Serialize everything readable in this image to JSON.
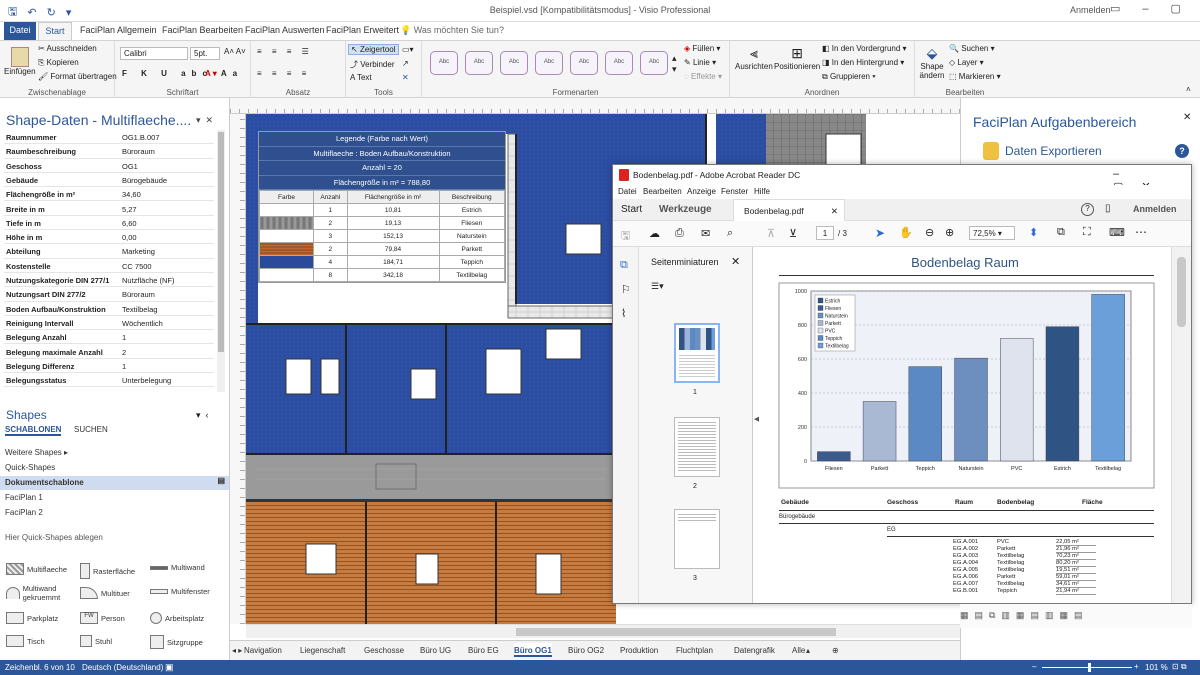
{
  "app": {
    "window_title": "Beispiel.vsd  [Kompatibilitätsmodus]  -  Visio Professional",
    "signin": "Anmelden"
  },
  "ribbon_tabs": [
    "Datei",
    "Start",
    "FaciPlan Allgemein",
    "FaciPlan Bearbeiten",
    "FaciPlan Auswerten",
    "FaciPlan Erweitert"
  ],
  "search_placeholder": "Was möchten Sie tun?",
  "ribbon": {
    "clipboard": {
      "paste": "Einfügen",
      "cut": "Ausschneiden",
      "copy": "Kopieren",
      "format": "Format übertragen",
      "label": "Zwischenablage"
    },
    "font": {
      "name": "Calibri",
      "size": "5pt.",
      "label": "Schriftart"
    },
    "paragraph": {
      "label": "Absatz"
    },
    "tools": {
      "pointer": "Zeigertool",
      "connector": "Verbinder",
      "text": "Text",
      "label": "Tools"
    },
    "shape_styles": {
      "sample": "Abc",
      "fill": "Füllen",
      "line": "Linie",
      "effects": "Effekte",
      "label": "Formenarten"
    },
    "arrange": {
      "align": "Ausrichten",
      "position": "Positionieren",
      "front": "In den Vordergrund",
      "back": "In den Hintergrund",
      "group": "Gruppieren",
      "label": "Anordnen"
    },
    "editing": {
      "change_shape": "Shape ändern",
      "find": "Suchen",
      "layer": "Layer",
      "select": "Markieren",
      "label": "Bearbeiten"
    }
  },
  "shape_data": {
    "title": "Shape-Daten - Multiflaeche....",
    "rows": [
      {
        "k": "Raumnummer",
        "v": "OG1.B.007"
      },
      {
        "k": "Raumbeschreibung",
        "v": "Büroraum"
      },
      {
        "k": "Geschoss",
        "v": "OG1"
      },
      {
        "k": "Gebäude",
        "v": "Bürogebäude"
      },
      {
        "k": "Flächengröße in m²",
        "v": "34,60"
      },
      {
        "k": "Breite in m",
        "v": "5,27"
      },
      {
        "k": "Tiefe in m",
        "v": "6,60"
      },
      {
        "k": "Höhe in m",
        "v": "0,00"
      },
      {
        "k": "Abteilung",
        "v": "Marketing"
      },
      {
        "k": "Kostenstelle",
        "v": "CC 7500"
      },
      {
        "k": "Nutzungskategorie DIN 277/1",
        "v": "Nutzfläche (NF)"
      },
      {
        "k": "Nutzungsart DIN 277/2",
        "v": "Büroraum"
      },
      {
        "k": "Boden Aufbau/Konstruktion",
        "v": "Textilbelag"
      },
      {
        "k": "Reinigung Intervall",
        "v": "Wöchentlich"
      },
      {
        "k": "Belegung Anzahl",
        "v": "1"
      },
      {
        "k": "Belegung maximale Anzahl",
        "v": "2"
      },
      {
        "k": "Belegung Differenz",
        "v": "1"
      },
      {
        "k": "Belegungsstatus",
        "v": "Unterbelegung"
      }
    ]
  },
  "shapes": {
    "title": "Shapes",
    "tab_templates": "SCHABLONEN",
    "tab_search": "SUCHEN",
    "more": "Weitere Shapes",
    "quick": "Quick-Shapes",
    "doc_template": "Dokumentschablone",
    "faci1": "FaciPlan 1",
    "faci2": "FaciPlan 2",
    "drop_hint": "Hier Quick-Shapes ablegen",
    "stencils": [
      "Multiflaeche",
      "Rasterfläche",
      "Multiwand",
      "Multiwand gekruemmt",
      "Multituer",
      "Multifenster",
      "Parkplatz",
      "Person",
      "Arbeitsplatz",
      "Tisch",
      "Stuhl",
      "Sitzgruppe"
    ]
  },
  "legend": {
    "title": "Legende (Farbe nach Wert)",
    "subtitle": "Multiflaeche : Boden Aufbau/Konstruktion",
    "count": "Anzahl = 20",
    "area": "Flächengröße in m² = 788,80",
    "headers": [
      "Farbe",
      "Anzahl",
      "Flächengröße in m²",
      "Beschreibung"
    ],
    "rows": [
      {
        "color": "#ffffff",
        "n": "1",
        "a": "10,81",
        "d": "Estrich"
      },
      {
        "color": "#888888",
        "n": "2",
        "a": "19,13",
        "d": "Fliesen"
      },
      {
        "color": "#ffffff",
        "n": "3",
        "a": "152,13",
        "d": "Naturstein"
      },
      {
        "color": "#c0662e",
        "n": "2",
        "a": "79,84",
        "d": "Parkett"
      },
      {
        "color": "#2b4a9c",
        "n": "4",
        "a": "184,71",
        "d": "Teppich"
      },
      {
        "color": "#ffffff",
        "n": "8",
        "a": "342,18",
        "d": "Textilbelag"
      }
    ]
  },
  "task_pane": {
    "title": "FaciPlan Aufgabenbereich",
    "export": "Daten Exportieren"
  },
  "acrobat": {
    "title": "Bodenbelag.pdf - Adobe Acrobat Reader DC",
    "menu": [
      "Datei",
      "Bearbeiten",
      "Anzeige",
      "Fenster",
      "Hilfe"
    ],
    "tab_home": "Start",
    "tab_tools": "Werkzeuge",
    "doc_tab": "Bodenbelag.pdf",
    "signin": "Anmelden",
    "page_current": "1",
    "page_total": "/ 3",
    "zoom": "72,5%",
    "thumbs_title": "Seitenminiaturen",
    "thumb_pages": [
      "1",
      "2",
      "3"
    ],
    "table_headers": [
      "Gebäude",
      "Geschoss",
      "Raum",
      "Bodenbelag",
      "Fläche"
    ],
    "building": "Bürogebäude",
    "floor": "EG",
    "rows": [
      {
        "r": "EG.A.001",
        "b": "PVC",
        "f": "22,05 m²"
      },
      {
        "r": "EG.A.002",
        "b": "Parkett",
        "f": "21,96 m²"
      },
      {
        "r": "EG.A.003",
        "b": "Textilbelag",
        "f": "70,23 m²"
      },
      {
        "r": "EG.A.004",
        "b": "Textilbelag",
        "f": "80,20 m²"
      },
      {
        "r": "EG.A.005",
        "b": "Textilbelag",
        "f": "19,51 m²"
      },
      {
        "r": "EG.A.006",
        "b": "Parkett",
        "f": "59,01 m²"
      },
      {
        "r": "EG.A.007",
        "b": "Textilbelag",
        "f": "34,61 m²"
      },
      {
        "r": "EG.B.001",
        "b": "Teppich",
        "f": "21,94 m²"
      }
    ]
  },
  "chart_data": {
    "type": "bar",
    "title": "Bodenbelag Raum",
    "categories": [
      "Fliesen",
      "Parkett",
      "Teppich",
      "Naturstein",
      "PVC",
      "Estrich",
      "Textilbelag"
    ],
    "values": [
      55,
      350,
      555,
      605,
      720,
      790,
      980
    ],
    "colors": [
      "#3b5b8f",
      "#a9b9d3",
      "#5b89c4",
      "#6d8fc0",
      "#dfe3ee",
      "#2f5484",
      "#6a9fd9"
    ],
    "ylim": [
      0,
      1000
    ],
    "yticks": [
      "0",
      "200",
      "400",
      "600",
      "800",
      "1000"
    ],
    "legend": [
      "Estrich",
      "Fliesen",
      "Naturstein",
      "Parkett",
      "PVC",
      "Teppich",
      "Textilbelag"
    ],
    "legend_colors": [
      "#2f5484",
      "#3b5b8f",
      "#6d8fc0",
      "#a9b9d3",
      "#dfe3ee",
      "#5b89c4",
      "#6a9fd9"
    ],
    "grid": true,
    "legend_position": "top-left"
  },
  "page_tabs": [
    "Navigation",
    "Liegenschaft",
    "Geschosse",
    "Büro UG",
    "Büro EG",
    "Büro OG1",
    "Büro OG2",
    "Produktion",
    "Fluchtplan",
    "Datengrafik",
    "Alle"
  ],
  "status": {
    "left": "Zeichenbl. 6 von 10",
    "lang": "Deutsch (Deutschland)",
    "zoom": "101 %"
  }
}
